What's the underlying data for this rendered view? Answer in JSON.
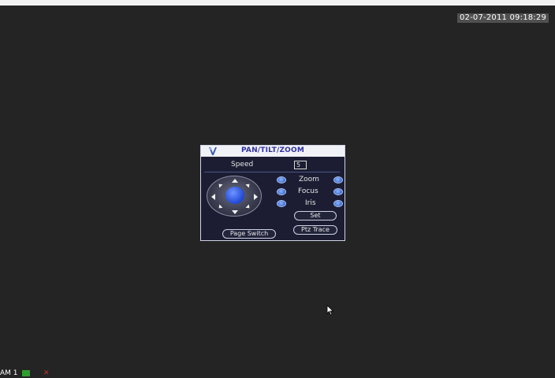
{
  "overlay": {
    "datetime": "02-07-2011 09:18:29",
    "channel_label": "AM 1"
  },
  "dialog": {
    "title": "PAN/TILT/ZOOM",
    "speed_label": "Speed",
    "speed_value": "5",
    "zoom_label": "Zoom",
    "focus_label": "Focus",
    "iris_label": "Iris",
    "set_label": "Set",
    "ptz_trace_label": "Ptz Trace",
    "page_switch_label": "Page Switch"
  },
  "icons": [
    "logo-icon",
    "arrow-up-icon",
    "arrow-down-icon",
    "arrow-left-icon",
    "arrow-right-icon",
    "mouse-cursor-icon",
    "record-icon",
    "alarm-icon"
  ],
  "colors": {
    "accent": "#2f54e0",
    "title": "#31309a",
    "background": "#242424"
  }
}
